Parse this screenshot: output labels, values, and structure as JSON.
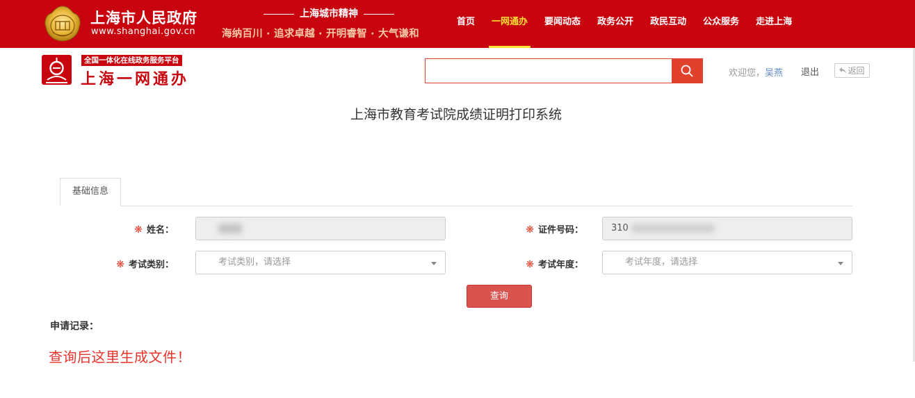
{
  "header": {
    "gov_title": "上海市人民政府",
    "gov_url": "www.shanghai.gov.cn",
    "spirit_title": "上海城市精神",
    "spirit_slogan": "海纳百川 · 追求卓越 · 开明睿智 · 大气谦和",
    "emblem_icon": "shanghai-emblem-icon",
    "nav": [
      {
        "label": "首页",
        "active": false
      },
      {
        "label": "一网通办",
        "active": true
      },
      {
        "label": "要闻动态",
        "active": false
      },
      {
        "label": "政务公开",
        "active": false
      },
      {
        "label": "政民互动",
        "active": false
      },
      {
        "label": "公众服务",
        "active": false
      },
      {
        "label": "走进上海",
        "active": false
      }
    ],
    "colors": {
      "bar": "#c8050f",
      "active_nav": "#ffe033"
    }
  },
  "subheader": {
    "logo_tagline": "全国一体化在线政务服务平台",
    "logo_name": "上海一网通办",
    "logo_icon": "yiwangtongban-logo-icon",
    "search_placeholder": "",
    "search_icon": "search-icon",
    "welcome_prefix": "欢迎您，",
    "username": "吴燕",
    "logout_label": "退出",
    "back_label": "返回",
    "back_icon": "return-arrow-icon"
  },
  "page": {
    "title": "上海市教育考试院成绩证明打印系统"
  },
  "form": {
    "tab_label": "基础信息",
    "name_label": "姓名：",
    "name_value": "",
    "id_label": "证件号码：",
    "id_value_prefix": "310",
    "exam_type_label": "考试类别：",
    "exam_type_placeholder": "考试类别，请选择",
    "exam_year_label": "考试年度：",
    "exam_year_placeholder": "考试年度，请选择",
    "required_mark": "❋",
    "query_label": "查询"
  },
  "records": {
    "label": "申请记录：",
    "message": "查询后这里生成文件！",
    "message_color": "#e8332b"
  }
}
